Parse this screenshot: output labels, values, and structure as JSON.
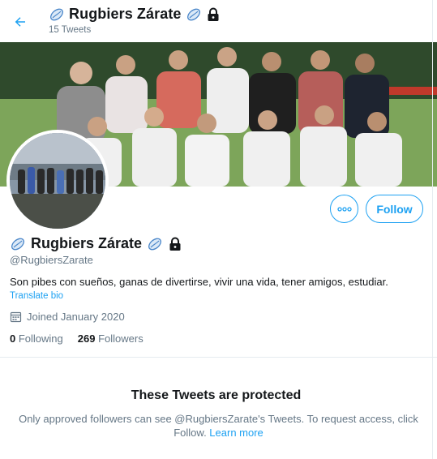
{
  "header": {
    "name": "Rugbiers Zárate",
    "tweet_count": "15 Tweets"
  },
  "profile": {
    "name": "Rugbiers Zárate",
    "handle": "@RugbiersZarate",
    "bio": "Son pibes con sueños, ganas de divertirse, vivir una vida, tener amigos, estudiar.",
    "translate_label": "Translate bio",
    "joined": "Joined January 2020",
    "following_count": "0",
    "following_label": " Following",
    "followers_count": "269",
    "followers_label": " Followers"
  },
  "actions": {
    "follow_label": "Follow",
    "more_icon": "more-horizontal-icon"
  },
  "protected": {
    "title": "These Tweets are protected",
    "text": "Only approved followers can see @RugbiersZarate's Tweets. To request access, click Follow. ",
    "learn_more": "Learn more"
  },
  "colors": {
    "accent": "#1da1f2",
    "secondary_text": "#657786",
    "primary_text": "#14171a"
  }
}
